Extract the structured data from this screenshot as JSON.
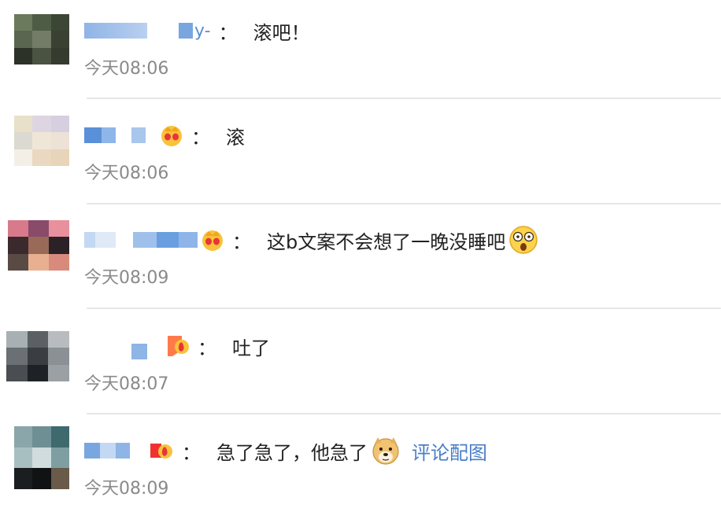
{
  "comments": [
    {
      "name_tail": "y-",
      "colon": "：",
      "text": "滚吧！",
      "time": "今天08:06",
      "badge": "none"
    },
    {
      "name_tail": "",
      "colon": "：",
      "text": "滚",
      "time": "今天08:06",
      "badge": "crown-badge"
    },
    {
      "name_tail": "",
      "colon": "：",
      "text": "这b文案不会想了一晚没睡吧",
      "emoji": "shocked-face-emoji",
      "time": "今天08:09",
      "badge": "crown-badge"
    },
    {
      "name_tail": "",
      "colon": "：",
      "text": "吐了",
      "time": "今天08:07",
      "badge": "flame-badge"
    },
    {
      "name_tail": "",
      "colon": "：",
      "text": "急了急了，他急了",
      "emoji": "doge-emoji",
      "link": "评论配图",
      "time": "今天08:09",
      "badge": "flame-badge"
    }
  ],
  "colors": {
    "text": "#222222",
    "time": "#8a8a8a",
    "link": "#4a7ec8",
    "divider": "#e6e6e6",
    "redacted_name": "#6fa0dc"
  }
}
